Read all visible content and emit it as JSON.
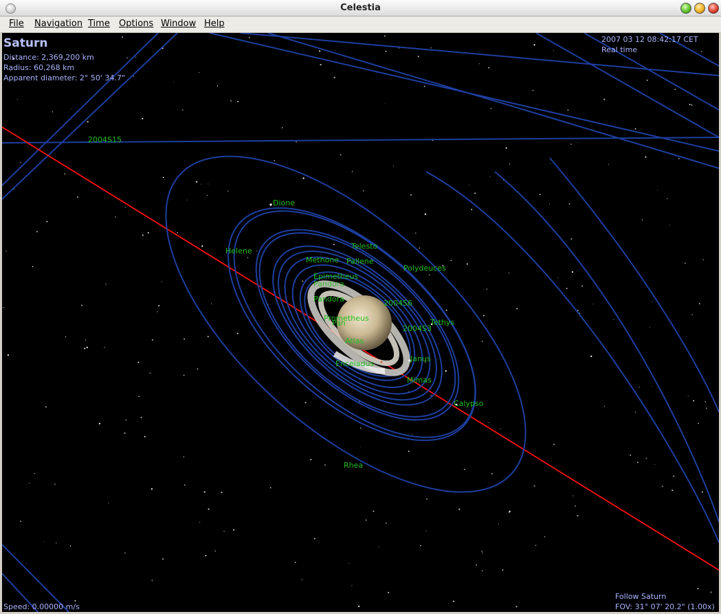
{
  "window": {
    "title": "Celestia"
  },
  "menu": [
    "File",
    "Navigation",
    "Time",
    "Options",
    "Window",
    "Help"
  ],
  "hud": {
    "target_name": "Saturn",
    "distance": "Distance: 2,369,200 km",
    "radius": "Radius: 60,268 km",
    "apparent_diameter": "Apparent diameter: 2° 50' 34.7\"",
    "datetime": "2007 03 12 08:42:17 CET",
    "time_mode": "Real time",
    "speed": "Speed: 0.00000 m/s",
    "follow": "Follow Saturn",
    "fov": "FOV: 31° 07' 20.2\" (1.00x)"
  },
  "moons": {
    "s2004s15": "2004S15",
    "dione": "Dione",
    "helene": "Helene",
    "telesto": "Telesto",
    "methone": "Methone",
    "pallene": "Pallene",
    "polydeuces": "Polydeuces",
    "epimetheus": "Epimetheus",
    "pandora_hidden": "Pandora",
    "pandora": "Pandora",
    "s2004s6": "2004S6",
    "tethys": "Tethys",
    "prometheus": "Prometheus",
    "pan": "Pan",
    "s2004s3": "2004S3",
    "atlas": "Atlas",
    "janus": "Janus",
    "enceladus": "Enceladus",
    "mimas": "Mimas",
    "calypso": "Calypso",
    "rhea": "Rhea"
  },
  "colors": {
    "orbit": "#1e3fa0",
    "ecliptic": "#ff1010",
    "label": "#1fbf1f",
    "hud": "#aab4ff"
  }
}
